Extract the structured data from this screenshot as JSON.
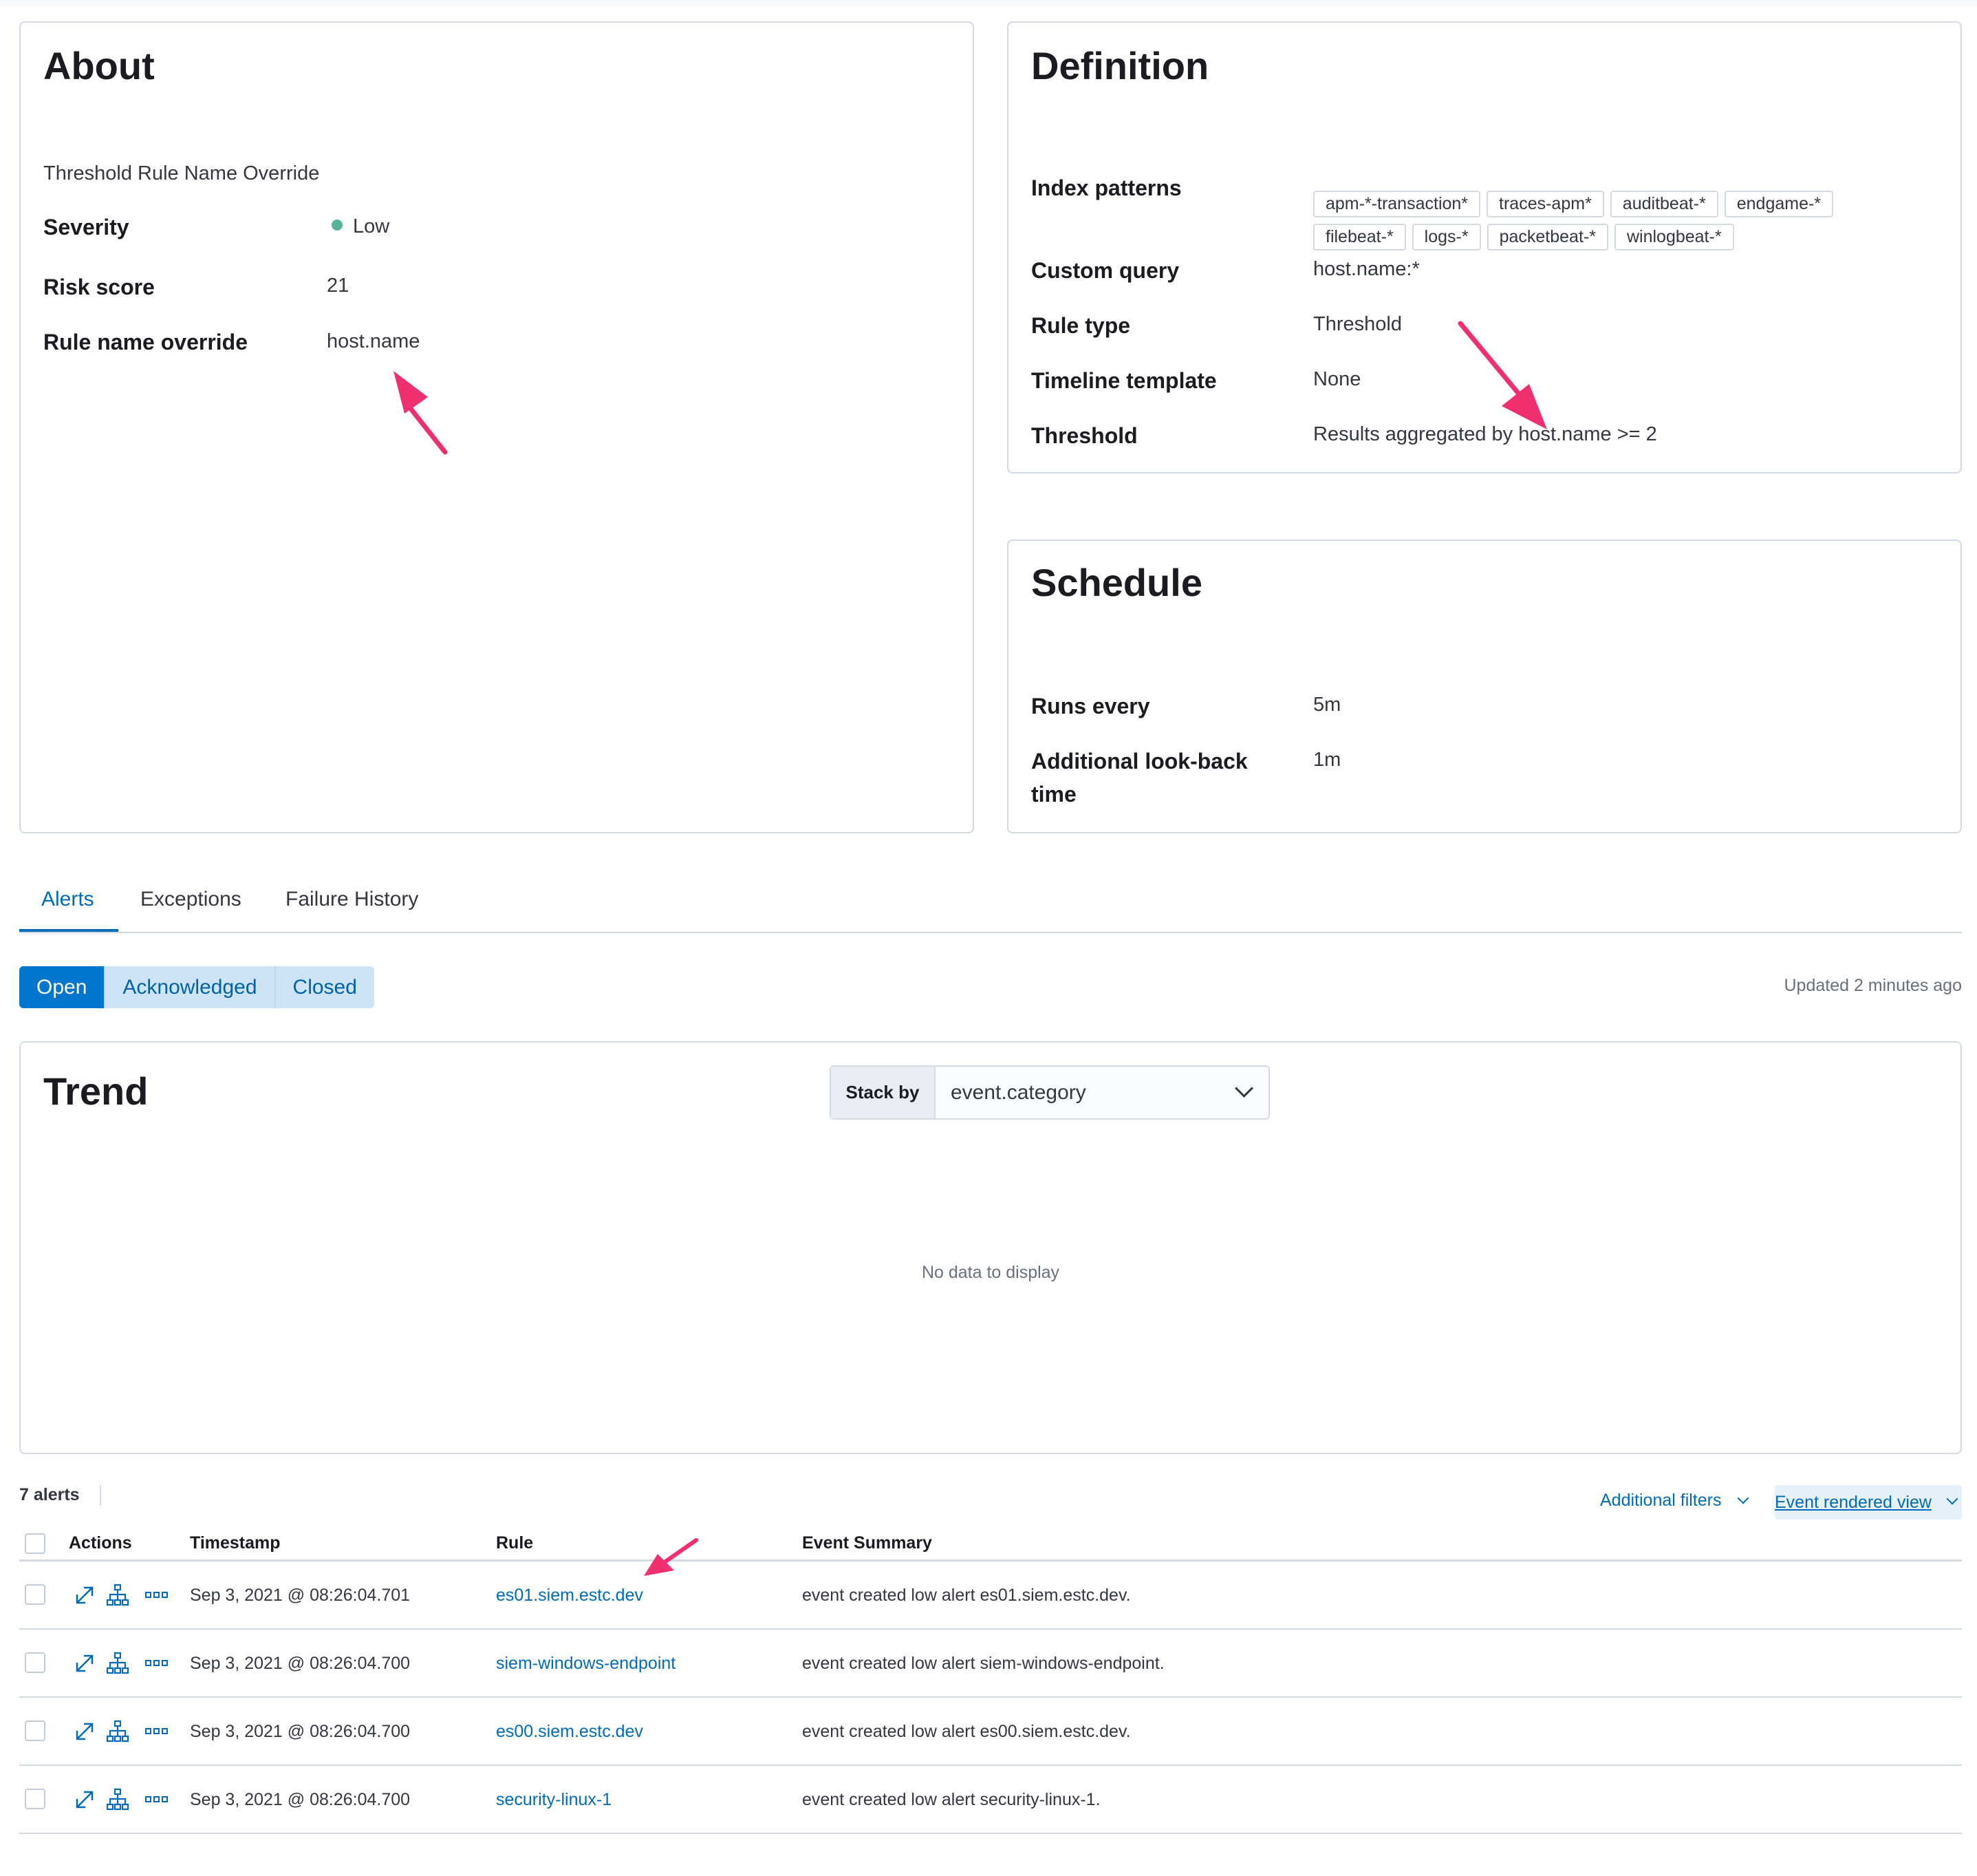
{
  "about": {
    "title": "About",
    "description": "Threshold Rule Name Override",
    "fields": [
      {
        "label": "Severity",
        "value": "Low"
      },
      {
        "label": "Risk score",
        "value": "21"
      },
      {
        "label": "Rule name override",
        "value": "host.name"
      }
    ],
    "severity_color": "#54b399"
  },
  "definition": {
    "title": "Definition",
    "index_patterns_label": "Index patterns",
    "index_patterns": [
      "apm-*-transaction*",
      "traces-apm*",
      "auditbeat-*",
      "endgame-*",
      "filebeat-*",
      "logs-*",
      "packetbeat-*",
      "winlogbeat-*"
    ],
    "fields": [
      {
        "label": "Custom query",
        "value": "host.name:*"
      },
      {
        "label": "Rule type",
        "value": "Threshold"
      },
      {
        "label": "Timeline template",
        "value": "None"
      },
      {
        "label": "Threshold",
        "value": "Results aggregated by host.name >= 2"
      }
    ]
  },
  "schedule": {
    "title": "Schedule",
    "fields": [
      {
        "label": "Runs every",
        "value": "5m"
      },
      {
        "label": "Additional look-back time",
        "value": "1m"
      }
    ]
  },
  "tabs": [
    {
      "label": "Alerts",
      "active": true
    },
    {
      "label": "Exceptions",
      "active": false
    },
    {
      "label": "Failure History",
      "active": false
    }
  ],
  "status_filter": {
    "options": [
      "Open",
      "Acknowledged",
      "Closed"
    ],
    "selected": "Open"
  },
  "updated_text": "Updated 2 minutes ago",
  "trend": {
    "title": "Trend",
    "stack_by_label": "Stack by",
    "stack_by_value": "event.category",
    "empty_text": "No data to display"
  },
  "alerts_table": {
    "count_text": "7 alerts",
    "additional_filters_label": "Additional filters",
    "view_label": "Event rendered view",
    "columns": [
      "Actions",
      "Timestamp",
      "Rule",
      "Event Summary"
    ],
    "rows": [
      {
        "timestamp": "Sep 3, 2021 @ 08:26:04.701",
        "rule": "es01.siem.estc.dev",
        "summary": "event created low alert es01.siem.estc.dev."
      },
      {
        "timestamp": "Sep 3, 2021 @ 08:26:04.700",
        "rule": "siem-windows-endpoint",
        "summary": "event created low alert siem-windows-endpoint."
      },
      {
        "timestamp": "Sep 3, 2021 @ 08:26:04.700",
        "rule": "es00.siem.estc.dev",
        "summary": "event created low alert es00.siem.estc.dev."
      },
      {
        "timestamp": "Sep 3, 2021 @ 08:26:04.700",
        "rule": "security-linux-1",
        "summary": "event created low alert security-linux-1."
      }
    ]
  },
  "colors": {
    "accent": "#006bb8",
    "annotation_arrow": "#f0306e",
    "border": "#d3dae6"
  }
}
